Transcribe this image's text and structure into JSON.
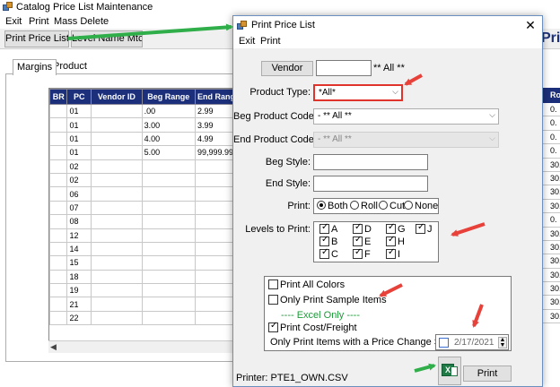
{
  "background_window": {
    "title": "Catalog Price List Maintenance",
    "menu": [
      "Exit",
      "Print",
      "Mass Delete"
    ],
    "toolbar": {
      "print_price_list": "Print Price List",
      "level_name_mtc": "Level Name Mtc"
    },
    "right_title": "Pri",
    "tabs": [
      "Margins",
      "Product"
    ],
    "grid": {
      "columns": [
        "BR",
        "PC",
        "Vendor ID",
        "Beg Range",
        "End Rang"
      ],
      "rows": [
        [
          "",
          "01",
          "",
          ".00",
          "2.99"
        ],
        [
          "",
          "01",
          "",
          "3.00",
          "3.99"
        ],
        [
          "",
          "01",
          "",
          "4.00",
          "4.99"
        ],
        [
          "",
          "01",
          "",
          "5.00",
          "99,999.99"
        ],
        [
          "",
          "02",
          "",
          "",
          ""
        ],
        [
          "",
          "02",
          "",
          "",
          ""
        ],
        [
          "",
          "06",
          "",
          "",
          ""
        ],
        [
          "",
          "07",
          "",
          "",
          ""
        ],
        [
          "",
          "08",
          "",
          "",
          ""
        ],
        [
          "",
          "12",
          "",
          "",
          ""
        ],
        [
          "",
          "14",
          "",
          "",
          ""
        ],
        [
          "",
          "15",
          "",
          "",
          ""
        ],
        [
          "",
          "18",
          "",
          "",
          ""
        ],
        [
          "",
          "19",
          "",
          "",
          ""
        ],
        [
          "",
          "21",
          "",
          "",
          ""
        ],
        [
          "",
          "22",
          "",
          "",
          ""
        ]
      ]
    },
    "right_column": {
      "header": "Rol",
      "values": [
        "0.",
        "0.",
        "0.",
        "0.",
        "30.",
        "30.",
        "30.",
        "30.",
        "0.",
        "30.",
        "30.",
        "30.",
        "30.",
        "30.",
        "30.",
        "30."
      ]
    }
  },
  "dialog": {
    "title": "Print Price List",
    "close": "✕",
    "menu": [
      "Exit",
      "Print"
    ],
    "vendor_button": "Vendor",
    "vendor_value": "",
    "vendor_all": "** All **",
    "product_type_label": "Product Type:",
    "product_type_value": "*All*",
    "beg_product_code_label": "Beg Product Code:",
    "beg_product_code_value": "- ** All **",
    "end_product_code_label": "End Product Code:",
    "end_product_code_value": "- ** All **",
    "beg_style_label": "Beg Style:",
    "end_style_label": "End Style:",
    "print_label": "Print:",
    "print_options": [
      "Both",
      "Roll",
      "Cut",
      "None"
    ],
    "print_selected": "Both",
    "levels_label": "Levels to Print:",
    "levels": [
      "A",
      "D",
      "G",
      "J",
      "B",
      "E",
      "H",
      "C",
      "F",
      "I"
    ],
    "print_all_colors": "Print All Colors",
    "only_print_sample_items": "Only Print Sample Items",
    "excel_only": "---- Excel Only ----",
    "print_cost_freight": "Print Cost/Freight",
    "price_change_label": "Only Print Items with a Price Change Since",
    "price_change_date": "2/17/2021",
    "printer": "Printer: PTE1_OWN.CSV",
    "print_button": "Print"
  },
  "colors": {
    "annotation_red": "#e8413a",
    "annotation_green": "#2fae4a",
    "grid_header": "#1c2f7a"
  }
}
